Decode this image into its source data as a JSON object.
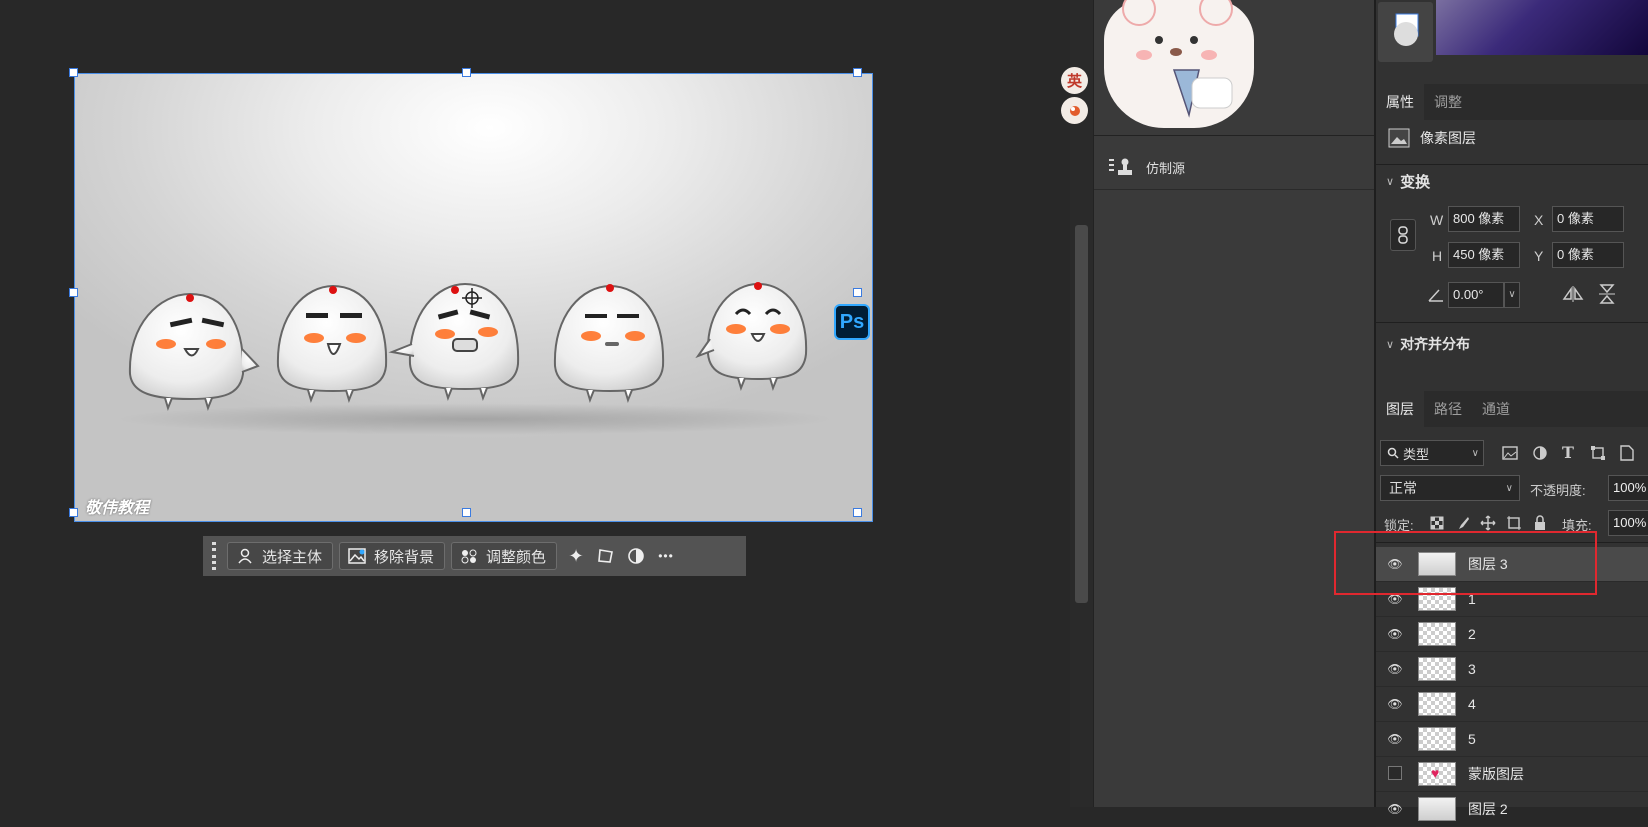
{
  "canvas": {
    "watermark": "敬伟教程",
    "ps_badge": "Ps"
  },
  "taskbar": {
    "select_subject": "选择主体",
    "remove_bg": "移除背景",
    "adjust_color": "调整颜色",
    "icons": [
      "magic-wand-icon",
      "transform-icon",
      "contrast-icon",
      "more-icon"
    ],
    "more": "•••"
  },
  "ime": {
    "lang": "英"
  },
  "mid_panel": {
    "clone_source": "仿制源"
  },
  "properties": {
    "tabs": [
      "属性",
      "调整"
    ],
    "layer_type": "像素图层",
    "transform_title": "变换",
    "w_label": "W",
    "w_value": "800 像素",
    "h_label": "H",
    "h_value": "450 像素",
    "x_label": "X",
    "x_value": "0 像素",
    "y_label": "Y",
    "y_value": "0 像素",
    "angle_value": "0.00°",
    "align_title": "对齐并分布"
  },
  "layers_panel": {
    "tabs": [
      "图层",
      "路径",
      "通道"
    ],
    "filter": "类型",
    "blend_mode": "正常",
    "opacity_label": "不透明度:",
    "opacity_value": "100%",
    "lock_label": "锁定:",
    "fill_label": "填充:",
    "fill_value": "100%",
    "layers": [
      {
        "name": "图层 3",
        "visible": true,
        "selected": true
      },
      {
        "name": "1",
        "visible": true
      },
      {
        "name": "2",
        "visible": true
      },
      {
        "name": "3",
        "visible": true
      },
      {
        "name": "4",
        "visible": true
      },
      {
        "name": "5",
        "visible": true
      },
      {
        "name": "蒙版图层",
        "visible": false
      },
      {
        "name": "图层 2",
        "visible": true
      }
    ]
  },
  "colors": {
    "selection_outline": "#e0282f",
    "transform_box": "#4a8fe8",
    "ps_blue": "#31a8ff"
  }
}
